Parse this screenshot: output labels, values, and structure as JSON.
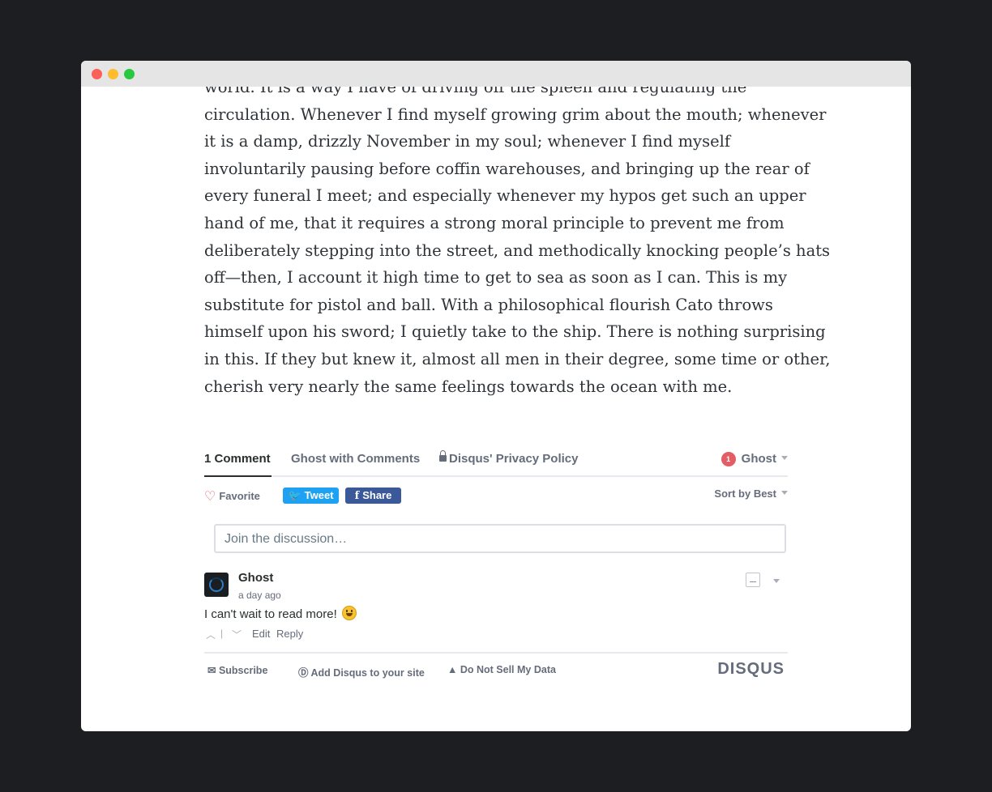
{
  "window": {
    "controls": [
      "close",
      "minimize",
      "maximize"
    ]
  },
  "article": {
    "lines": [
      "world. It is a way I have of driving off the spleen and regulating the",
      "circulation. Whenever I find myself growing grim about the mouth; whenever",
      "it is a damp, drizzly November in my soul; whenever I find myself",
      "involuntarily pausing before coffin warehouses, and bringing up the rear of",
      "every funeral I meet; and especially whenever my hypos get such an upper",
      "hand of me, that it requires a strong moral principle to prevent me from",
      "deliberately stepping into the street, and methodically knocking people’s hats",
      "off—then, I account it high time to get to sea as soon as I can. This is my",
      "substitute for pistol and ball. With a philosophical flourish Cato throws",
      "himself upon his sword; I quietly take to the ship. There is nothing surprising",
      "in this. If they but knew it, almost all men in their degree, some time or other,",
      "cherish very nearly the same feelings towards the ocean with me."
    ]
  },
  "disqus": {
    "tabs": {
      "comments": "1 Comment",
      "community": "Ghost with Comments",
      "privacy": "Disqus' Privacy Policy"
    },
    "user": {
      "badge": "1",
      "name": "Ghost"
    },
    "actions": {
      "favorite": "Favorite",
      "tweet": "Tweet",
      "share": "Share",
      "sort": "Sort by Best"
    },
    "input": {
      "placeholder": "Join the discussion…"
    },
    "comment": {
      "author": "Ghost",
      "time": "a day ago",
      "text": "I can't wait to read more!",
      "edit": "Edit",
      "reply": "Reply",
      "separator": "|"
    },
    "footer": {
      "subscribe": "Subscribe",
      "add": "Add Disqus to your site",
      "dnsmd": "Do Not Sell My Data",
      "logo": "DISQUS"
    },
    "colors": {
      "accent_red": "#e25d64",
      "tweet": "#1da1f2",
      "facebook": "#3b5998"
    }
  }
}
